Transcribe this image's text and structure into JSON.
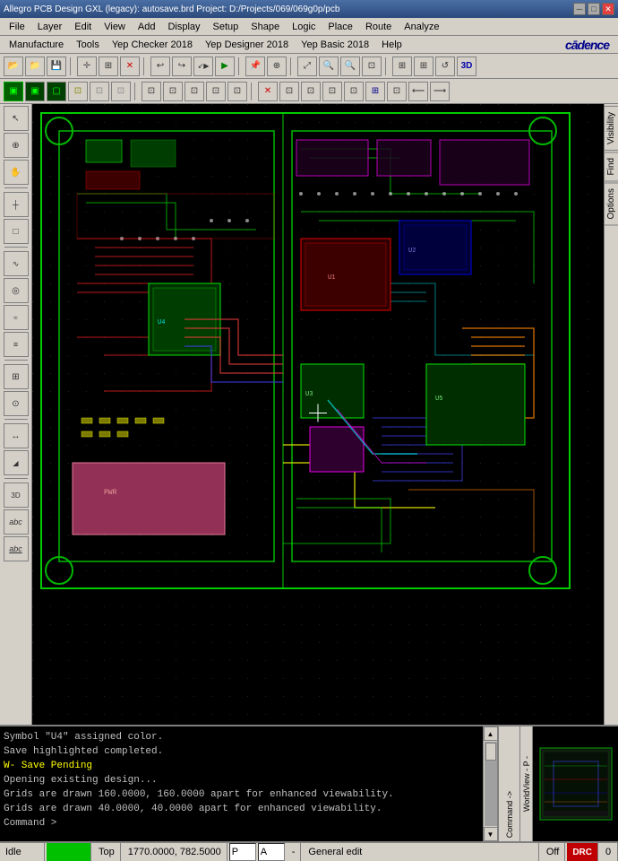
{
  "titlebar": {
    "title": "Allegro PCB Design GXL (legacy): autosave.brd  Project: D:/Projects/069/069g0p/pcb",
    "minimize": "─",
    "maximize": "□",
    "close": "✕"
  },
  "menubar": {
    "items": [
      "File",
      "Layer",
      "Edit",
      "View",
      "Add",
      "Display",
      "Setup",
      "Shape",
      "Logic",
      "Place",
      "Route",
      "Analyze"
    ]
  },
  "menubar2": {
    "items": [
      "Manufacture",
      "Tools",
      "Yep Checker 2018",
      "Yep Designer 2018",
      "Yep Basic 2018",
      "Help"
    ],
    "logo": "cādence"
  },
  "toolbar1": {
    "buttons": [
      "📁",
      "💾",
      "✂",
      "⬛",
      "↩",
      "↪",
      "↙",
      "▶",
      "📌",
      "⊕",
      "↔",
      "🔍",
      "🔍",
      "🔍",
      "🔍",
      "⊞",
      "⊞",
      "⊞",
      "⊞",
      "↺"
    ]
  },
  "toolbar2": {
    "buttons": [
      "⊡",
      "⊡",
      "⊡",
      "⊡",
      "⊡",
      "⊡",
      "⊡",
      "⊡",
      "⊡",
      "⊡",
      "⊡",
      "⊡",
      "✕",
      "⊡",
      "⊡",
      "⊡"
    ]
  },
  "left_toolbar": {
    "buttons": [
      "⊡",
      "⊡",
      "⊡",
      "⊡",
      "⊡",
      "⊡",
      "⊡",
      "⊡",
      "⊡",
      "⊡",
      "⊡",
      "⊡",
      "⊡",
      "⊡",
      "⊡",
      "abc",
      "abc"
    ]
  },
  "right_panel": {
    "tabs": [
      "Visibility",
      "Find",
      "Options"
    ]
  },
  "console": {
    "lines": [
      "Symbol \"U4\" assigned color.",
      "Save highlighted completed.",
      "W- Save Pending",
      "Opening existing design...",
      "Grids are drawn 160.0000, 160.0000 apart for enhanced viewability.",
      "Grids are drawn 40.0000, 40.0000 apart for enhanced viewability.",
      "Command >"
    ],
    "label": "Command ->"
  },
  "worldview": {
    "label": "WorldView - P -"
  },
  "statusbar": {
    "mode": "Idle",
    "layer": "Top",
    "coords": "1770.0000, 782.5000",
    "flag1": "P",
    "flag2": "A",
    "separator": "-",
    "edit_mode": "General edit",
    "off": "Off",
    "indicator": "DRC",
    "count": "0"
  }
}
